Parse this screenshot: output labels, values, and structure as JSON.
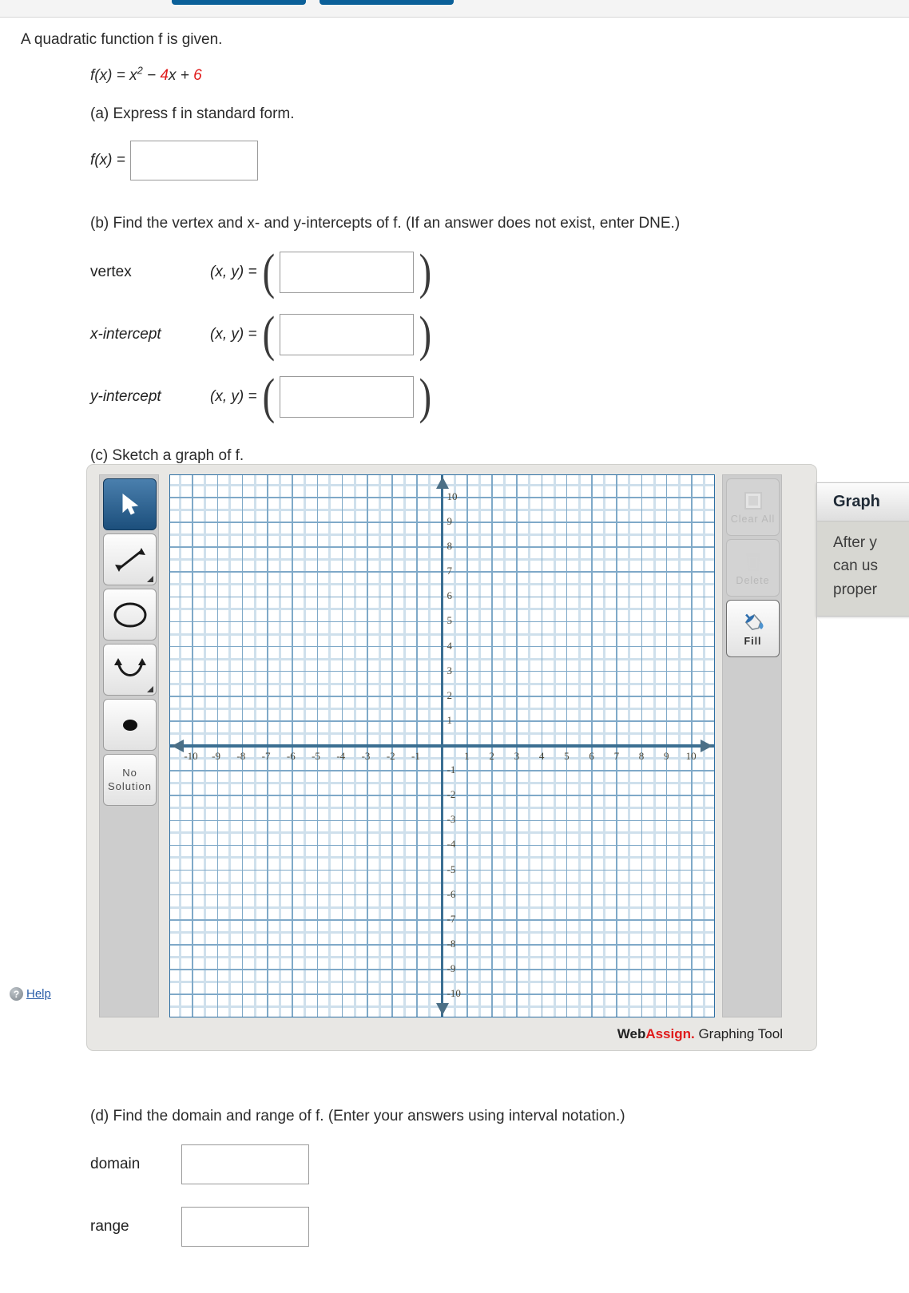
{
  "topbar": {
    "buttons": [
      "",
      ""
    ]
  },
  "question": {
    "intro": "A quadratic function f is given.",
    "formula": {
      "lhs": "f(x) = x",
      "exponent": "2",
      "mid": " − ",
      "coef": "4",
      "var": "x + ",
      "constant": "6"
    },
    "parts": {
      "a": {
        "prompt": "(a) Express f in standard form.",
        "label": "f(x) =",
        "answer": "",
        "placeholder": ""
      },
      "b": {
        "prompt": "(b) Find the vertex and x- and y-intercepts of f. (If an answer does not exist, enter DNE.)",
        "rows": [
          {
            "name": "vertex",
            "coords_label": "(x, y) =",
            "answer": "",
            "open_paren": "(",
            "close_paren": ")"
          },
          {
            "name": "x-intercept",
            "coords_label": "(x, y) =",
            "answer": "",
            "open_paren": "(",
            "close_paren": ")"
          },
          {
            "name": "y-intercept",
            "coords_label": "(x, y) =",
            "answer": "",
            "open_paren": "(",
            "close_paren": ")"
          }
        ]
      },
      "c": {
        "prompt": "(c) Sketch a graph of f."
      },
      "d": {
        "prompt": "(d) Find the domain and range of f. (Enter your answers using interval notation.)",
        "rows": [
          {
            "name": "domain",
            "answer": ""
          },
          {
            "name": "range",
            "answer": ""
          }
        ]
      }
    }
  },
  "graphing_tool": {
    "brand_web": "Web",
    "brand_assign": "Assign.",
    "brand_rest": " Graphing Tool",
    "help_label": "Help",
    "help_icon": "?",
    "left_tools": [
      {
        "icon": "cursor-icon",
        "label": "",
        "selected": true
      },
      {
        "icon": "line-segment-icon",
        "label": "",
        "selected": false
      },
      {
        "icon": "circle-icon",
        "label": "",
        "selected": false
      },
      {
        "icon": "parabola-icon",
        "label": "",
        "selected": false
      },
      {
        "icon": "point-icon",
        "label": "",
        "selected": false
      },
      {
        "icon": "no-solution-icon",
        "label": "No Solution",
        "selected": false
      }
    ],
    "right_tools": [
      {
        "icon": "clear-all-icon",
        "label": "Clear All",
        "enabled": false
      },
      {
        "icon": "trash-icon",
        "label": "Delete",
        "enabled": false
      },
      {
        "icon": "fill-bucket-icon",
        "label": "Fill",
        "enabled": true
      }
    ]
  },
  "chart_data": {
    "type": "scatter",
    "title": "",
    "xlabel": "",
    "ylabel": "",
    "xlim": [
      -10.9,
      10.9
    ],
    "ylim": [
      -10.9,
      10.9
    ],
    "xticks": [
      -10,
      -9,
      -8,
      -7,
      -6,
      -5,
      -4,
      -3,
      -2,
      -1,
      1,
      2,
      3,
      4,
      5,
      6,
      7,
      8,
      9,
      10
    ],
    "yticks": [
      10,
      9,
      8,
      7,
      6,
      5,
      4,
      3,
      2,
      1,
      -1,
      -2,
      -3,
      -4,
      -5,
      -6,
      -7,
      -8,
      -9,
      -10
    ],
    "grid": true,
    "minor_grid_step": 0.5,
    "major_grid_step": 1,
    "series": [],
    "legend": "none"
  },
  "popup": {
    "title": "Graph",
    "lines": [
      "After y",
      "can us",
      "proper"
    ]
  },
  "colors": {
    "accent_blue": "#0b6099",
    "red": "#e01b1b",
    "grid_minor": "#cfe0ec",
    "grid_major": "#7fa9c8",
    "axis": "#3b6f92",
    "link": "#2a5da8"
  }
}
